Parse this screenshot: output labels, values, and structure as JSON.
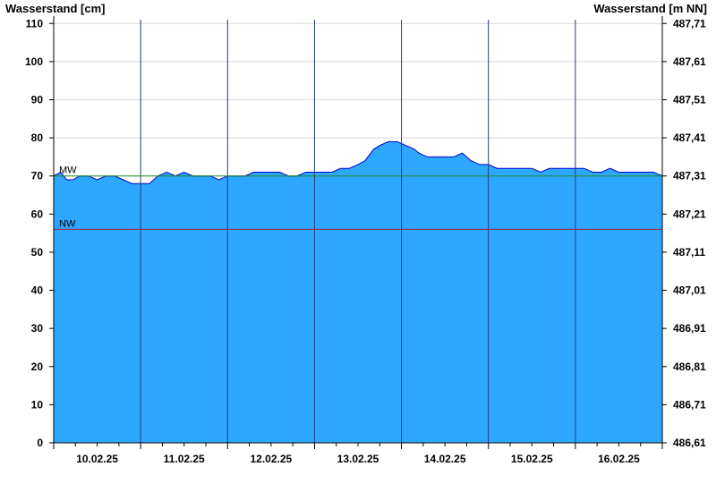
{
  "chart_data": {
    "type": "area",
    "y_left_label": "Wasserstand [cm]",
    "y_right_label": "Wasserstand [m NN]",
    "ylim": [
      0,
      111
    ],
    "y_ticks": [
      0,
      10,
      20,
      30,
      40,
      50,
      60,
      70,
      80,
      90,
      100,
      110
    ],
    "y_tick_labels": [
      "0",
      "10",
      "20",
      "30",
      "40",
      "50",
      "60",
      "70",
      "80",
      "90",
      "100",
      "110"
    ],
    "y2_ticks": [
      0,
      10,
      20,
      30,
      40,
      50,
      60,
      70,
      80,
      90,
      100,
      110
    ],
    "y2_tick_labels": [
      "486,61",
      "486,71",
      "486,81",
      "486,91",
      "487,01",
      "487,11",
      "487,21",
      "487,31",
      "487,41",
      "487,51",
      "487,61",
      "487,71"
    ],
    "xlim": [
      9.7,
      16.7
    ],
    "x_day_starts": [
      9.7,
      10.7,
      11.7,
      12.7,
      13.7,
      14.7,
      15.7,
      16.7
    ],
    "x_ticks": [
      10.2,
      11.2,
      12.2,
      13.2,
      14.2,
      15.2,
      16.2
    ],
    "x_tick_labels": [
      "10.02.25",
      "11.02.25",
      "12.02.25",
      "13.02.25",
      "14.02.25",
      "15.02.25",
      "16.02.25"
    ],
    "grid": true,
    "reference_lines": [
      {
        "label": "MW",
        "value": 70,
        "color": "#228b22"
      },
      {
        "label": "NW",
        "value": 56,
        "color": "#b22234"
      }
    ],
    "series": [
      {
        "color": "#0000cc",
        "fill": "#2ea7ff",
        "points": [
          [
            9.7,
            70
          ],
          [
            9.78,
            71
          ],
          [
            9.85,
            69
          ],
          [
            9.92,
            69
          ],
          [
            10.0,
            70
          ],
          [
            10.1,
            70
          ],
          [
            10.2,
            69
          ],
          [
            10.3,
            70
          ],
          [
            10.4,
            70
          ],
          [
            10.5,
            69
          ],
          [
            10.6,
            68
          ],
          [
            10.7,
            68
          ],
          [
            10.8,
            68
          ],
          [
            10.9,
            70
          ],
          [
            11.0,
            71
          ],
          [
            11.1,
            70
          ],
          [
            11.2,
            71
          ],
          [
            11.3,
            70
          ],
          [
            11.4,
            70
          ],
          [
            11.5,
            70
          ],
          [
            11.6,
            69
          ],
          [
            11.7,
            70
          ],
          [
            11.8,
            70
          ],
          [
            11.9,
            70
          ],
          [
            12.0,
            71
          ],
          [
            12.1,
            71
          ],
          [
            12.2,
            71
          ],
          [
            12.3,
            71
          ],
          [
            12.4,
            70
          ],
          [
            12.5,
            70
          ],
          [
            12.6,
            71
          ],
          [
            12.7,
            71
          ],
          [
            12.8,
            71
          ],
          [
            12.9,
            71
          ],
          [
            13.0,
            72
          ],
          [
            13.1,
            72
          ],
          [
            13.2,
            73
          ],
          [
            13.28,
            74
          ],
          [
            13.38,
            77
          ],
          [
            13.45,
            78
          ],
          [
            13.55,
            79
          ],
          [
            13.65,
            79
          ],
          [
            13.75,
            78
          ],
          [
            13.85,
            77
          ],
          [
            13.9,
            76
          ],
          [
            14.0,
            75
          ],
          [
            14.1,
            75
          ],
          [
            14.2,
            75
          ],
          [
            14.3,
            75
          ],
          [
            14.4,
            76
          ],
          [
            14.5,
            74
          ],
          [
            14.6,
            73
          ],
          [
            14.7,
            73
          ],
          [
            14.8,
            72
          ],
          [
            14.9,
            72
          ],
          [
            15.0,
            72
          ],
          [
            15.1,
            72
          ],
          [
            15.2,
            72
          ],
          [
            15.3,
            71
          ],
          [
            15.4,
            72
          ],
          [
            15.5,
            72
          ],
          [
            15.6,
            72
          ],
          [
            15.7,
            72
          ],
          [
            15.8,
            72
          ],
          [
            15.9,
            71
          ],
          [
            16.0,
            71
          ],
          [
            16.1,
            72
          ],
          [
            16.2,
            71
          ],
          [
            16.3,
            71
          ],
          [
            16.4,
            71
          ],
          [
            16.5,
            71
          ],
          [
            16.6,
            71
          ],
          [
            16.7,
            70
          ]
        ]
      }
    ]
  }
}
